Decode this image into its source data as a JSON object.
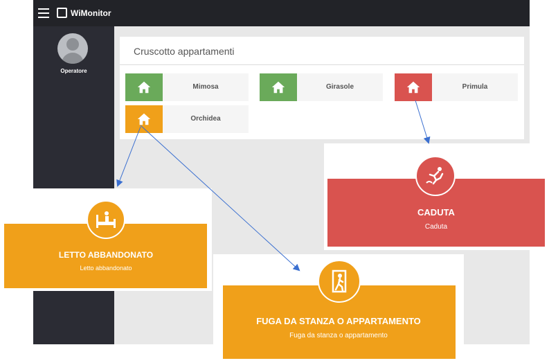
{
  "app": {
    "name": "WiMonitor"
  },
  "sidebar": {
    "user_label": "Operatore"
  },
  "dashboard": {
    "title": "Cruscotto appartamenti",
    "apartments": [
      {
        "name": "Mimosa",
        "status_color": "#6aaa5a",
        "icon": "home-icon"
      },
      {
        "name": "Girasole",
        "status_color": "#6aaa5a",
        "icon": "home-icon"
      },
      {
        "name": "Primula",
        "status_color": "#d9534f",
        "icon": "home-icon"
      },
      {
        "name": "Orchidea",
        "status_color": "#f0a01a",
        "icon": "home-icon"
      }
    ]
  },
  "alerts": {
    "fall": {
      "title": "CADUTA",
      "subtitle": "Caduta",
      "color": "#d9534f",
      "icon": "falling-person-icon"
    },
    "bed": {
      "title": "LETTO ABBANDONATO",
      "subtitle": "Letto abbandonato",
      "color": "#f0a01a",
      "icon": "bed-icon"
    },
    "escape": {
      "title": "FUGA DA STANZA O APPARTAMENTO",
      "subtitle": "Fuga da stanza o appartamento",
      "color": "#f0a01a",
      "icon": "door-exit-icon"
    }
  },
  "colors": {
    "arrow": "#3a6fd0",
    "topbar": "#222328",
    "sidebar": "#2b2c34"
  }
}
